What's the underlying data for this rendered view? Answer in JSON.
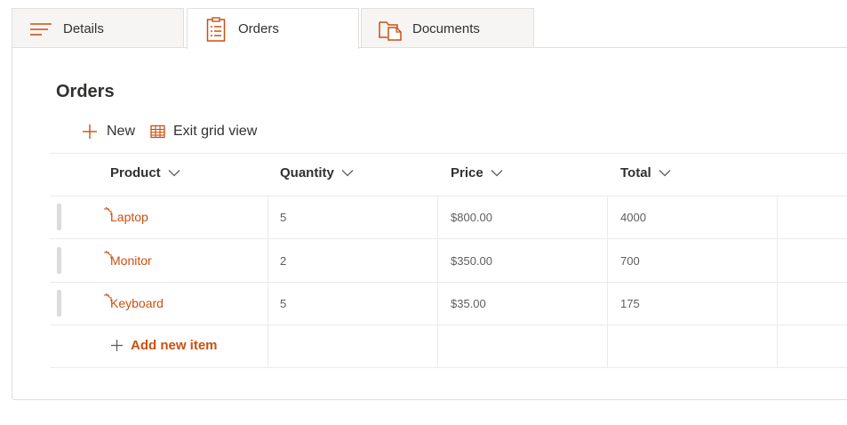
{
  "tabs": [
    {
      "label": "Details",
      "icon": "lines-icon",
      "active": false
    },
    {
      "label": "Orders",
      "icon": "form-icon",
      "active": true
    },
    {
      "label": "Documents",
      "icon": "folder-document-icon",
      "active": false
    }
  ],
  "section": {
    "title": "Orders"
  },
  "commands": {
    "new_label": "New",
    "exit_grid_label": "Exit grid view"
  },
  "grid": {
    "columns": [
      "Product",
      "Quantity",
      "Price",
      "Total"
    ],
    "rows": [
      {
        "product": "Laptop",
        "quantity": "5",
        "price": "$800.00",
        "total": "4000"
      },
      {
        "product": "Monitor",
        "quantity": "2",
        "price": "$350.00",
        "total": "700"
      },
      {
        "product": "Keyboard",
        "quantity": "5",
        "price": "$35.00",
        "total": "175"
      }
    ],
    "add_label": "Add new item"
  },
  "colors": {
    "accent": "#ca5010",
    "text": "#323130",
    "border": "#e1dfdd"
  }
}
